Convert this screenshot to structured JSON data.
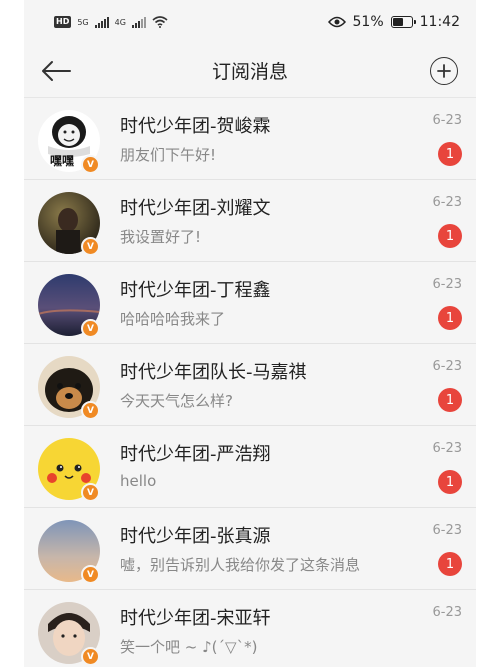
{
  "status_bar": {
    "hd": "HD",
    "signal_1": "5G",
    "signal_2": "4G",
    "battery": "51%",
    "time": "11:42",
    "battery_level": 0.51
  },
  "header": {
    "title": "订阅消息",
    "back_icon": "arrow-left-icon",
    "add_icon": "plus-circle-icon"
  },
  "messages": [
    {
      "sender": "时代少年团-贺峻霖",
      "preview": "朋友们下午好!",
      "date": "6-23",
      "unread": "1",
      "avatar_caption": "嘿嘿",
      "verified": "V"
    },
    {
      "sender": "时代少年团-刘耀文",
      "preview": "我设置好了!",
      "date": "6-23",
      "unread": "1",
      "verified": "V"
    },
    {
      "sender": "时代少年团-丁程鑫",
      "preview": "哈哈哈哈我来了",
      "date": "6-23",
      "unread": "1",
      "verified": "V"
    },
    {
      "sender": "时代少年团队长-马嘉祺",
      "preview": "今天天气怎么样?",
      "date": "6-23",
      "unread": "1",
      "verified": "V"
    },
    {
      "sender": "时代少年团-严浩翔",
      "preview": "hello",
      "date": "6-23",
      "unread": "1",
      "verified": "V"
    },
    {
      "sender": "时代少年团-张真源",
      "preview": "嘘，别告诉别人我给你发了这条消息",
      "date": "6-23",
      "unread": "1",
      "verified": "V"
    },
    {
      "sender": "时代少年团-宋亚轩",
      "preview": "笑一个吧 ~ ♪(´▽`*)",
      "date": "6-23",
      "unread": "",
      "verified": "V"
    }
  ]
}
